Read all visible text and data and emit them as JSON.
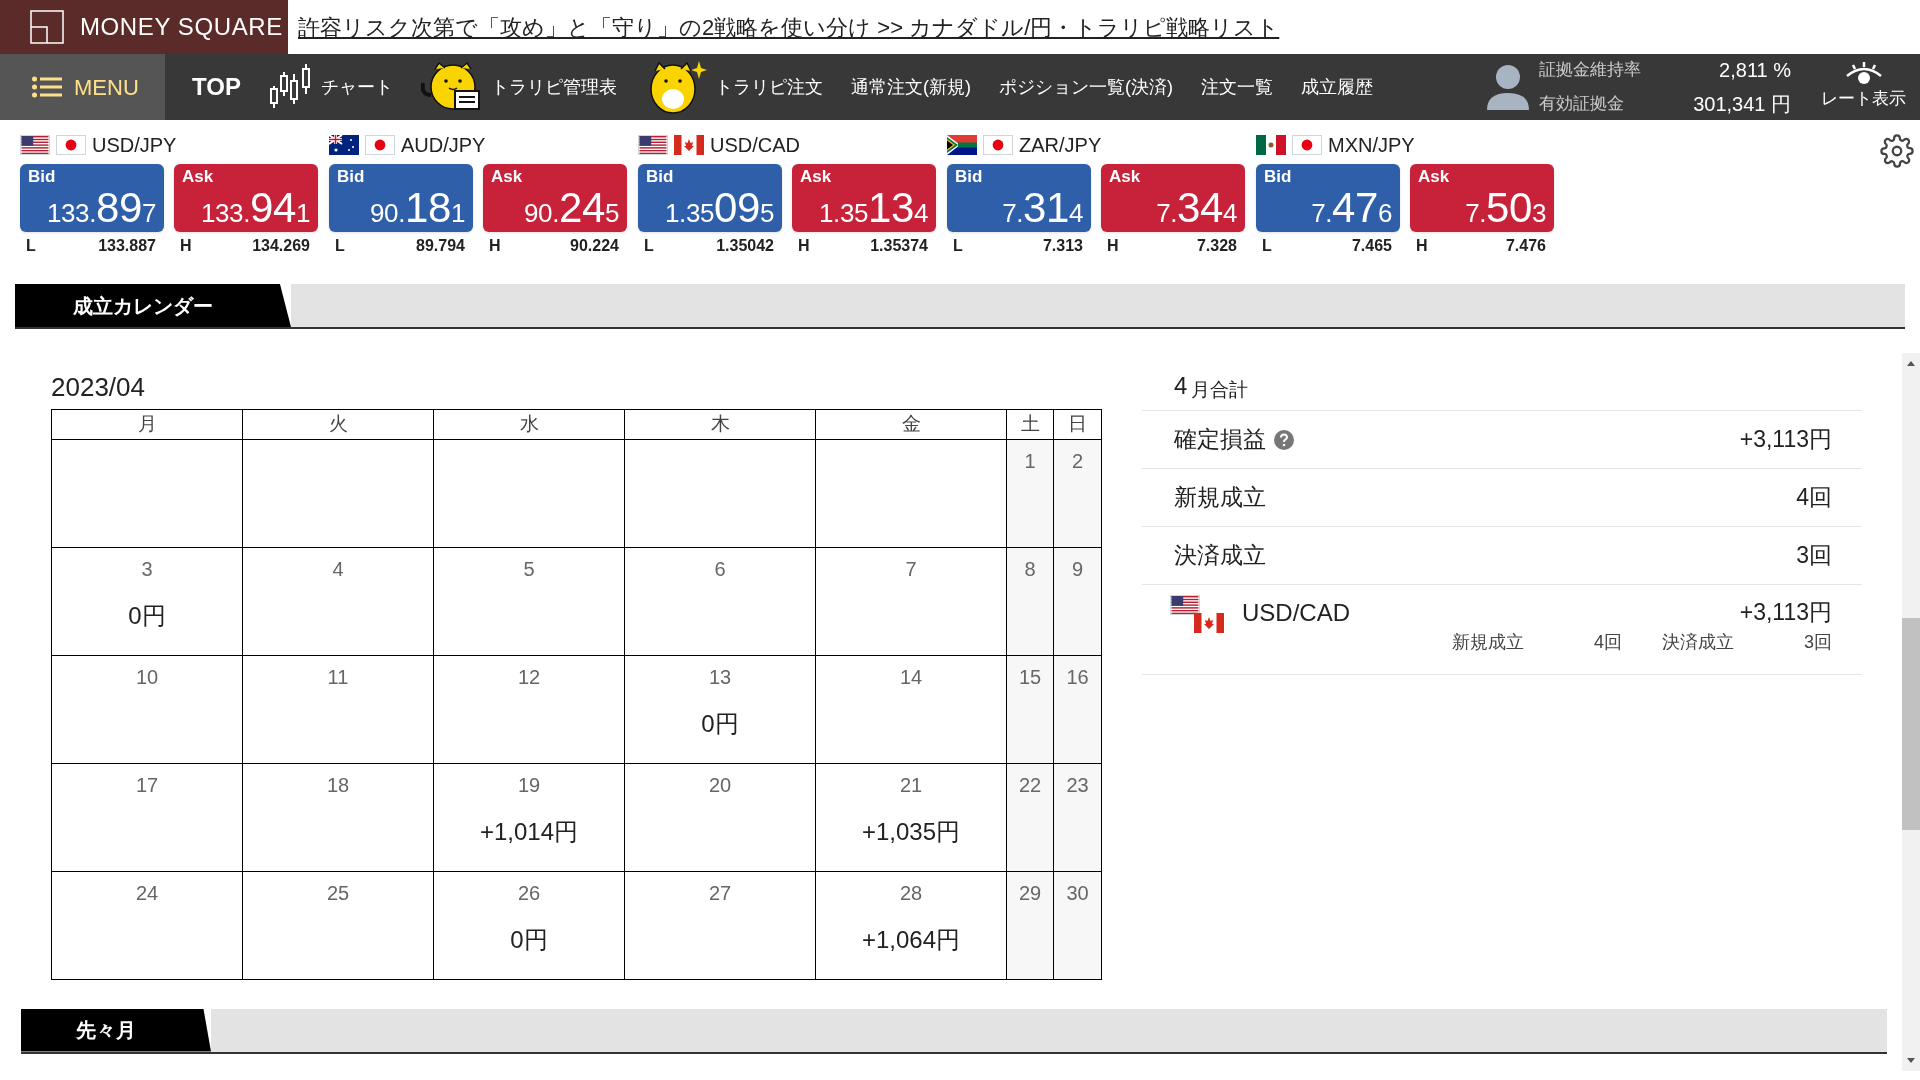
{
  "banner": {
    "logo": "MONEY SQUARE",
    "link": "許容リスク次第で「攻め」と「守り」の2戦略を使い分け >> カナダドル/円・トラリピ戦略リスト"
  },
  "nav": {
    "menu": "MENU",
    "items": [
      {
        "label": "TOP",
        "kind": "plain"
      },
      {
        "label": "チャート",
        "kind": "chart"
      },
      {
        "label": "トラリピ管理表",
        "kind": "mascot-table"
      },
      {
        "label": "トラリピ注文",
        "kind": "mascot"
      },
      {
        "label": "通常注文(新規)",
        "kind": "text"
      },
      {
        "label": "ポジション一覧(決済)",
        "kind": "text"
      },
      {
        "label": "注文一覧",
        "kind": "text"
      },
      {
        "label": "成立履歴",
        "kind": "text"
      }
    ],
    "account": [
      {
        "label": "証拠金維持率",
        "value": "2,811 %"
      },
      {
        "label": "有効証拠金",
        "value": "301,341 円"
      }
    ],
    "rate_toggle": "レート表示"
  },
  "rates": [
    {
      "pair": "USD/JPY",
      "kind": "us-jp",
      "bid": {
        "label": "Bid",
        "prefix": "133.",
        "big": "89",
        "pip": "7"
      },
      "ask": {
        "label": "Ask",
        "prefix": "133.",
        "big": "94",
        "pip": "1"
      },
      "low": {
        "label": "L",
        "value": "133.887"
      },
      "high": {
        "label": "H",
        "value": "134.269"
      }
    },
    {
      "pair": "AUD/JPY",
      "kind": "au-jp",
      "bid": {
        "label": "Bid",
        "prefix": "90.",
        "big": "18",
        "pip": "1"
      },
      "ask": {
        "label": "Ask",
        "prefix": "90.",
        "big": "24",
        "pip": "5"
      },
      "low": {
        "label": "L",
        "value": "89.794"
      },
      "high": {
        "label": "H",
        "value": "90.224"
      }
    },
    {
      "pair": "USD/CAD",
      "kind": "us-ca",
      "bid": {
        "label": "Bid",
        "prefix": "1.35",
        "big": "09",
        "pip": "5"
      },
      "ask": {
        "label": "Ask",
        "prefix": "1.35",
        "big": "13",
        "pip": "4"
      },
      "low": {
        "label": "L",
        "value": "1.35042"
      },
      "high": {
        "label": "H",
        "value": "1.35374"
      }
    },
    {
      "pair": "ZAR/JPY",
      "kind": "za-jp",
      "bid": {
        "label": "Bid",
        "prefix": "7.",
        "big": "31",
        "pip": "4"
      },
      "ask": {
        "label": "Ask",
        "prefix": "7.",
        "big": "34",
        "pip": "4"
      },
      "low": {
        "label": "L",
        "value": "7.313"
      },
      "high": {
        "label": "H",
        "value": "7.328"
      }
    },
    {
      "pair": "MXN/JPY",
      "kind": "mx-jp",
      "bid": {
        "label": "Bid",
        "prefix": "7.",
        "big": "47",
        "pip": "6"
      },
      "ask": {
        "label": "Ask",
        "prefix": "7.",
        "big": "50",
        "pip": "3"
      },
      "low": {
        "label": "L",
        "value": "7.465"
      },
      "high": {
        "label": "H",
        "value": "7.476"
      }
    }
  ],
  "calendar": {
    "title": "成立カレンダー",
    "month": "2023/04",
    "weekdays": [
      "月",
      "火",
      "水",
      "木",
      "金",
      "土",
      "日"
    ],
    "weeks": [
      [
        {
          "day": "1"
        },
        {
          "day": "2"
        }
      ],
      [
        {
          "day": "3",
          "amount": "0円"
        },
        {
          "day": "4"
        },
        {
          "day": "5"
        },
        {
          "day": "6"
        },
        {
          "day": "7"
        },
        {
          "day": "8"
        },
        {
          "day": "9"
        }
      ],
      [
        {
          "day": "10"
        },
        {
          "day": "11"
        },
        {
          "day": "12"
        },
        {
          "day": "13",
          "amount": "0円"
        },
        {
          "day": "14"
        },
        {
          "day": "15"
        },
        {
          "day": "16"
        }
      ],
      [
        {
          "day": "17"
        },
        {
          "day": "18"
        },
        {
          "day": "19",
          "amount": "+1,014円"
        },
        {
          "day": "20"
        },
        {
          "day": "21",
          "amount": "+1,035円"
        },
        {
          "day": "22"
        },
        {
          "day": "23"
        }
      ],
      [
        {
          "day": "24"
        },
        {
          "day": "25"
        },
        {
          "day": "26",
          "amount": "0円"
        },
        {
          "day": "27"
        },
        {
          "day": "28",
          "amount": "+1,064円"
        },
        {
          "day": "29"
        },
        {
          "day": "30"
        }
      ]
    ]
  },
  "summary": {
    "month": "4",
    "title": "月合計",
    "rows": [
      {
        "label": "確定損益",
        "help": true,
        "value": "+3,113円"
      },
      {
        "label": "新規成立",
        "help": false,
        "value": "4回"
      },
      {
        "label": "決済成立",
        "help": false,
        "value": "3回"
      }
    ],
    "pairs": [
      {
        "pair": "USD/CAD",
        "kind": "us-ca",
        "value": "+3,113円",
        "stats": [
          {
            "label": "新規成立",
            "value": "4回"
          },
          {
            "label": "決済成立",
            "value": "3回"
          }
        ]
      }
    ]
  },
  "next_section": {
    "title": "先々月"
  }
}
